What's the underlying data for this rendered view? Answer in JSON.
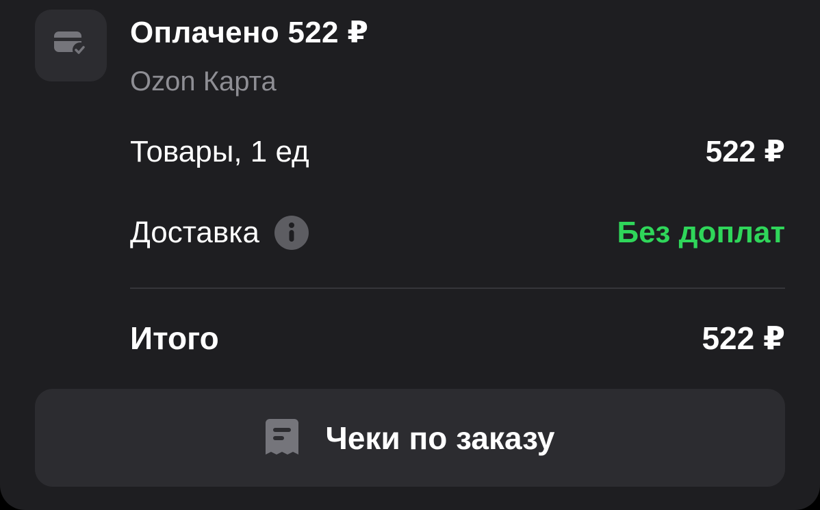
{
  "payment": {
    "status": "Оплачено 522 ₽",
    "method": "Ozon Карта",
    "icon": "card-check-icon"
  },
  "summary": {
    "items_label": "Товары, 1 ед",
    "items_value": "522 ₽",
    "delivery_label": "Доставка",
    "delivery_value": "Без доплат",
    "delivery_info_icon": "info-icon",
    "total_label": "Итого",
    "total_value": "522 ₽"
  },
  "receipts_button": {
    "label": "Чеки по заказу",
    "icon": "receipt-icon"
  },
  "colors": {
    "background": "#1e1e21",
    "surface": "#2c2c30",
    "accent_green": "#2fd65a",
    "muted_text": "#8e8e94"
  }
}
